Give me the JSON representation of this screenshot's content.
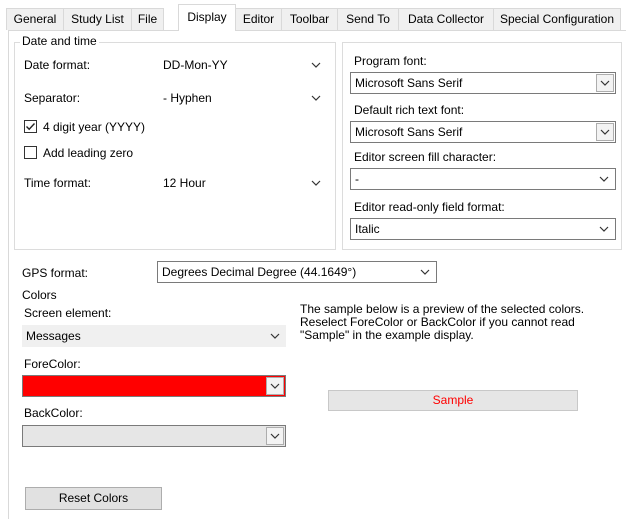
{
  "tabs": [
    {
      "label": "General"
    },
    {
      "label": "Study List"
    },
    {
      "label": "File"
    },
    {
      "label": "Display",
      "active": true
    },
    {
      "label": "Editor"
    },
    {
      "label": "Toolbar"
    },
    {
      "label": "Send To"
    },
    {
      "label": "Data Collector"
    },
    {
      "label": "Special Configuration"
    }
  ],
  "date_time": {
    "legend": "Date and time",
    "date_format_label": "Date format:",
    "date_format_value": "DD-Mon-YY",
    "separator_label": "Separator:",
    "separator_value": "- Hyphen",
    "four_digit_year_label": "4 digit year (YYYY)",
    "four_digit_year_checked": true,
    "leading_zero_label": "Add leading zero",
    "leading_zero_checked": false,
    "time_format_label": "Time format:",
    "time_format_value": "12 Hour"
  },
  "fonts": {
    "program_font_label": "Program font:",
    "program_font_value": "Microsoft Sans Serif",
    "rich_text_font_label": "Default rich text font:",
    "rich_text_font_value": "Microsoft Sans Serif",
    "fill_char_label": "Editor screen fill character:",
    "fill_char_value": "-",
    "readonly_format_label": "Editor read-only field format:",
    "readonly_format_value": "Italic"
  },
  "gps": {
    "label": "GPS format:",
    "value": "Degrees Decimal Degree (44.1649°)"
  },
  "colors": {
    "legend": "Colors",
    "screen_element_label": "Screen element:",
    "screen_element_value": "Messages",
    "forecolor_label": "ForeColor:",
    "forecolor_value": "#ff0000",
    "backcolor_label": "BackColor:",
    "backcolor_value": "#e6e6e6",
    "preview_text": "The sample below is a preview of the selected colors. Reselect ForeColor or BackColor if you cannot read \"Sample\"  in the example display.",
    "sample_label": "Sample",
    "sample_text_color": "#ff0000",
    "reset_button": "Reset Colors"
  }
}
